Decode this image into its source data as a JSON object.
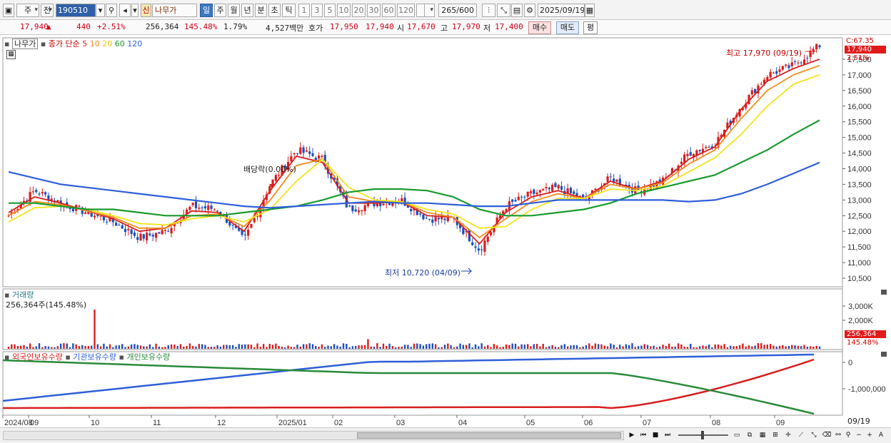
{
  "toolbar": {
    "market_type": "주",
    "period_prev": "전",
    "stock_code": "190510",
    "new_badge": "신",
    "stock_name": "나무가",
    "period_tabs": [
      "일",
      "주",
      "월",
      "년",
      "분",
      "초",
      "틱"
    ],
    "selected_period": "일",
    "interval_buttons": [
      "1",
      "3",
      "5",
      "10",
      "20",
      "30",
      "60",
      "120"
    ],
    "bar_count": "265",
    "bar_max": "/600",
    "date": "2025/09/19"
  },
  "info": {
    "price": "17,940",
    "change_symbol": "▲",
    "change": "440",
    "change_rate": "+2.51%",
    "volume": "256,364",
    "volume_ratio": "145.48%",
    "turnover": "1.79%",
    "trade_value": "4,527백만",
    "ask_label": "호가",
    "ask": "17,950",
    "bid": "17,940",
    "open_label": "시",
    "open": "17,670",
    "high_label": "고",
    "high": "17,970",
    "low_label": "저",
    "low": "17,400",
    "buy_label": "매수",
    "sell_label": "매도",
    "eval_label": "평"
  },
  "price_panel": {
    "name_tag": "나무가",
    "ma_label": "종가 단순",
    "ma_periods": [
      "5",
      "10",
      "20",
      "60",
      "120"
    ],
    "ma_colors": [
      "#d81e1e",
      "#f08c1e",
      "#f2e31a",
      "#1a9a2e",
      "#2f5fd8"
    ],
    "axis_ticks": [
      "10,500",
      "11,000",
      "11,500",
      "12,000",
      "12,500",
      "13,000",
      "13,500",
      "14,000",
      "14,500",
      "15,000",
      "15,500",
      "16,000",
      "16,500",
      "17,000",
      "17,500"
    ],
    "top_tag": "C:67.35",
    "price_tag": "17,940",
    "pct_tag": "2.51%",
    "high_annotation": "최고 17,970 (09/19)",
    "low_annotation": "최저 10,720 (04/09)",
    "dividend_annotation": "배당락(0.00%)"
  },
  "volume_panel": {
    "title": "거래량",
    "current": "256,364주(145.48%)",
    "axis_ticks": [
      "3,000K",
      "2,000K"
    ],
    "tag_volume": "256,364",
    "tag_pct": "145.48%"
  },
  "holding_panel": {
    "labels": [
      "외국인보유수량",
      "기관보유수량",
      "개인보유수량"
    ],
    "colors": [
      "#d81e1e",
      "#2f5fd8",
      "#2a8a3a"
    ],
    "axis_ticks": [
      "0",
      "-1,000,000"
    ]
  },
  "date_axis": [
    "2024/08",
    "09",
    "10",
    "11",
    "12",
    "2025/01",
    "02",
    "03",
    "04",
    "05",
    "06",
    "07",
    "08",
    "09"
  ],
  "date_axis_right": "09/19",
  "chart_data": {
    "type": "line",
    "title": "나무가",
    "y_range": [
      10500,
      17500
    ],
    "key_points": [
      {
        "label": "최고",
        "date": "09/19",
        "value": 17970
      },
      {
        "label": "최저",
        "date": "04/09",
        "value": 10720
      }
    ],
    "close_path": [
      12500,
      13300,
      12900,
      12600,
      12300,
      11800,
      12000,
      12800,
      12700,
      11700,
      13500,
      14600,
      14300,
      12700,
      12900,
      13000,
      12400,
      12400,
      11400,
      12800,
      13200,
      13400,
      13000,
      13700,
      13300,
      13600,
      14500,
      14800,
      16000,
      17000,
      17300,
      17940
    ],
    "series": [
      {
        "name": "5",
        "values": [
          12600,
          13100,
          12900,
          12650,
          12400,
          12000,
          12100,
          12650,
          12600,
          12000,
          13300,
          14400,
          14200,
          12900,
          12900,
          12950,
          12500,
          12450,
          11600,
          12600,
          13100,
          13300,
          13050,
          13600,
          13350,
          13600,
          14300,
          14700,
          15900,
          16800,
          17200,
          17500
        ]
      },
      {
        "name": "10",
        "values": [
          12500,
          12950,
          12850,
          12650,
          12450,
          12100,
          12100,
          12500,
          12550,
          12150,
          13000,
          14100,
          14300,
          13100,
          12950,
          12950,
          12600,
          12450,
          11800,
          12400,
          12950,
          13200,
          13050,
          13500,
          13350,
          13550,
          14150,
          14600,
          15600,
          16500,
          17000,
          17300
        ]
      },
      {
        "name": "20",
        "values": [
          12300,
          12750,
          12800,
          12700,
          12500,
          12250,
          12200,
          12400,
          12500,
          12300,
          12700,
          13600,
          14300,
          13400,
          13000,
          12950,
          12700,
          12550,
          12100,
          12150,
          12700,
          13050,
          13050,
          13350,
          13300,
          13450,
          13900,
          14350,
          15100,
          16000,
          16700,
          17000
        ]
      },
      {
        "name": "60",
        "values": [
          12900,
          12900,
          12800,
          12700,
          12700,
          12600,
          12500,
          12500,
          12500,
          12600,
          12700,
          12800,
          13000,
          13250,
          13350,
          13350,
          13300,
          13100,
          12700,
          12500,
          12500,
          12600,
          12700,
          12900,
          13200,
          13400,
          13600,
          13800,
          14200,
          14600,
          15100,
          15550
        ]
      },
      {
        "name": "120",
        "values": [
          13900,
          13700,
          13500,
          13400,
          13300,
          13200,
          13100,
          13000,
          12900,
          12800,
          12750,
          12800,
          12850,
          12900,
          12950,
          12900,
          12900,
          12850,
          12800,
          12800,
          12900,
          13000,
          13000,
          13000,
          13000,
          13000,
          12950,
          13000,
          13200,
          13500,
          13850,
          14200
        ]
      }
    ]
  }
}
